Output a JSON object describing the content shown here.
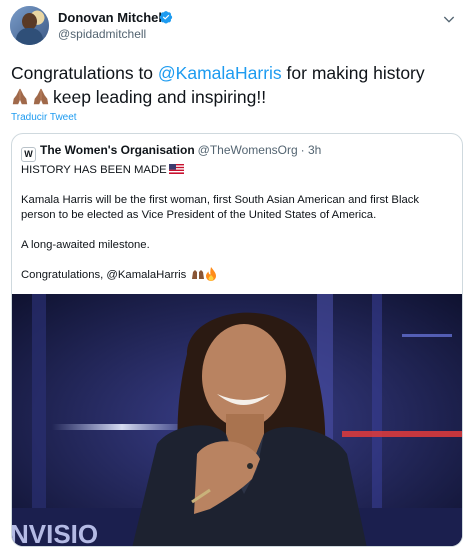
{
  "author": {
    "name": "Donovan Mitchell",
    "handle": "@spidadmitchell",
    "icons": {
      "verified": "verified-badge-icon",
      "more": "chevron-down-icon"
    }
  },
  "tweet": {
    "text_before": "Congratulations to ",
    "mention": "@KamalaHarris",
    "text_after": " for making history",
    "line2": "keep leading and inspiring!!",
    "emoji": "folded-hands-emoji x2",
    "translate_label": "Traducir Tweet"
  },
  "quote": {
    "name": "The Women's Organisation",
    "handle": "@TheWomensOrg",
    "time": "· 3h",
    "logo_letter": "W",
    "line1": "HISTORY HAS BEEN MADE",
    "line2": "Kamala Harris will be the first woman, first South Asian American and first Black person to be elected as Vice President of the United States of America.",
    "line3": "A long-awaited milestone.",
    "line4": "Congratulations, @KamalaHarris",
    "line4_emoji": "raised-hands-and-fire-emoji",
    "flag_icon": "us-flag-icon",
    "photo_text": "NVISIO"
  },
  "colors": {
    "accent": "#1d9bf0",
    "text": "#0f1419",
    "secondary": "#536471",
    "border": "#cfd9de"
  }
}
